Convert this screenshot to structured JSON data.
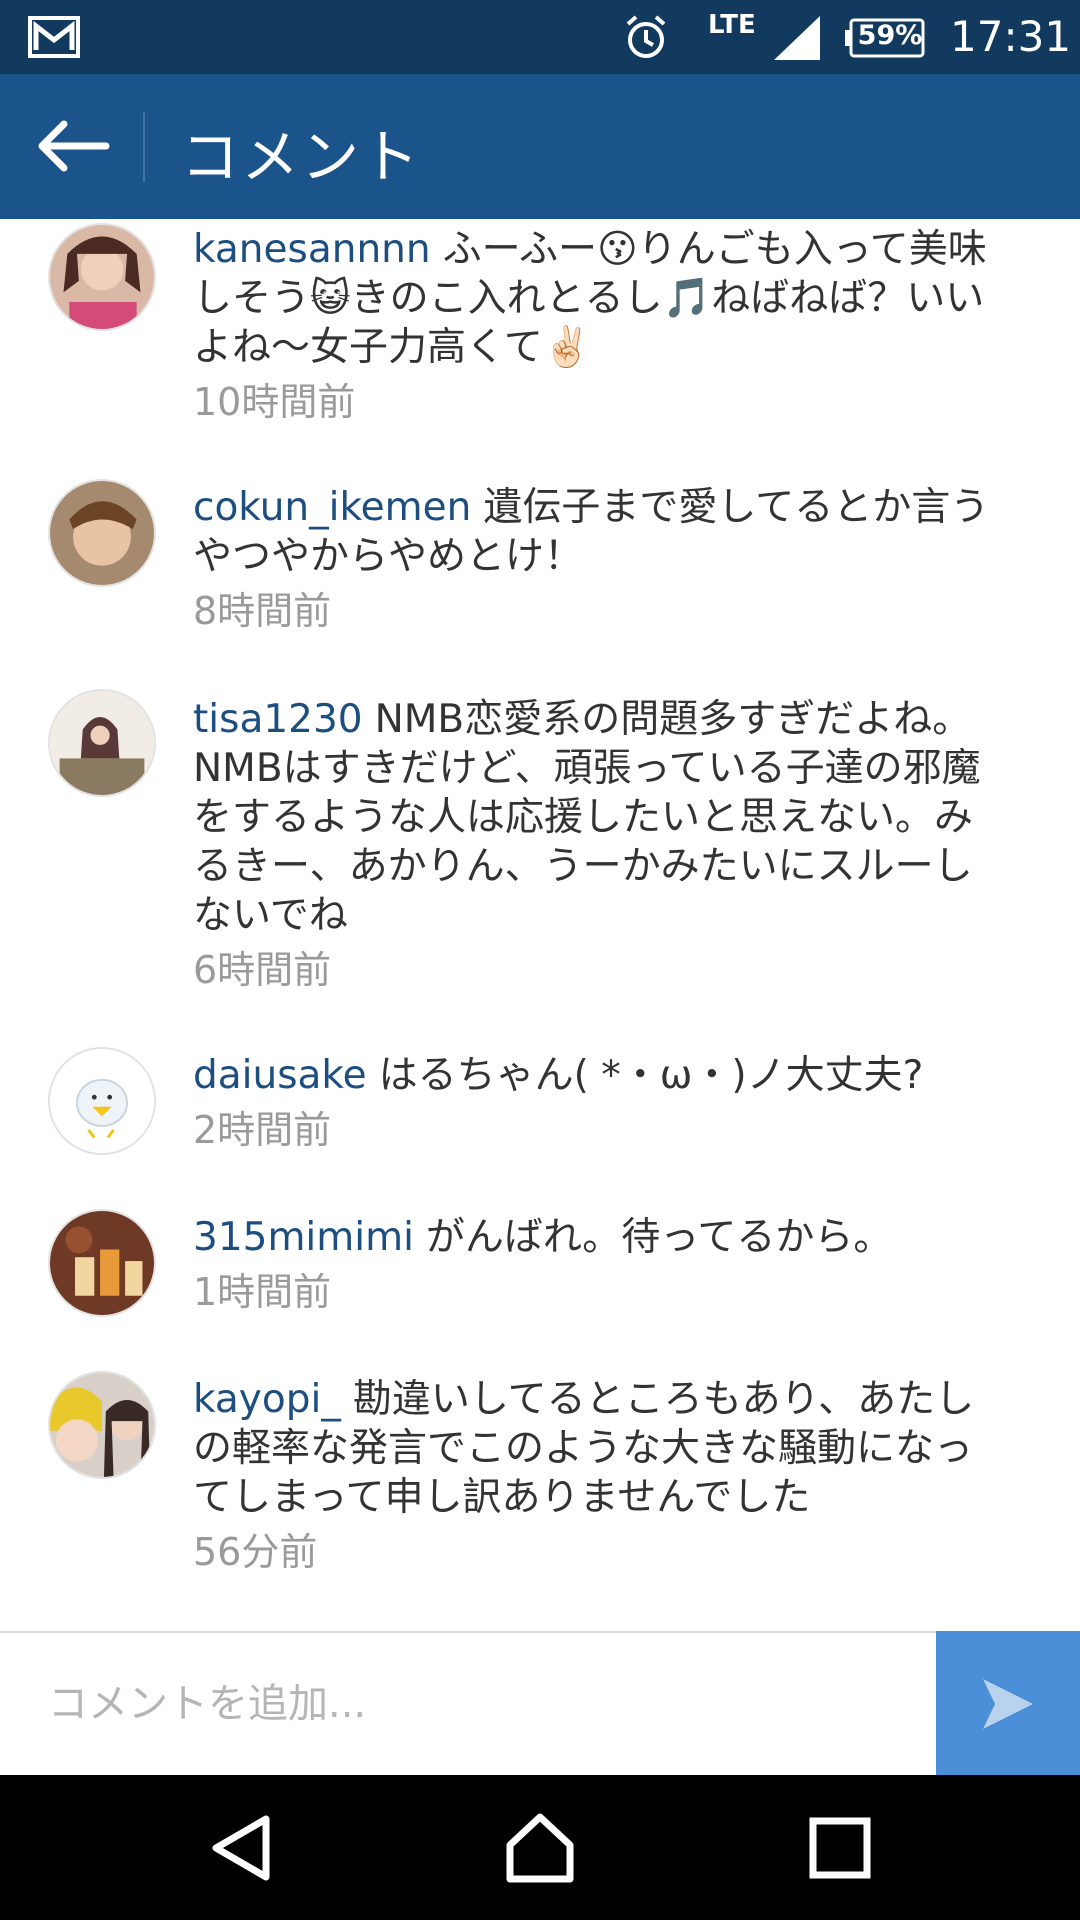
{
  "status_bar": {
    "network": "LTE",
    "battery": "59%",
    "time": "17:31",
    "icons": [
      "mail-icon",
      "alarm-icon",
      "signal-icon",
      "battery-icon"
    ]
  },
  "header": {
    "title": "コメント",
    "back_icon": "arrow-left-icon"
  },
  "comments": [
    {
      "username": "kanesannnn",
      "text": "ふーふー😗りんごも入って美味しそう😺きのこ入れとるし🎵ねばねば？いいよね〜女子力高くて✌🏻",
      "time": "10時間前"
    },
    {
      "username": "cokun_ikemen",
      "text": "遺伝子まで愛してるとか言うやつやからやめとけ！",
      "time": "8時間前"
    },
    {
      "username": "tisa1230",
      "text": "NMB恋愛系の問題多すぎだよね。NMBはすきだけど、頑張っている子達の邪魔をするような人は応援したいと思えない。みるきー、あかりん、うーかみたいにスルーしないでね",
      "time": "6時間前"
    },
    {
      "username": "daiusake",
      "text": "はるちゃん( *・ω・)ノ大丈夫?",
      "time": "2時間前"
    },
    {
      "username": "315mimimi",
      "text": "がんばれ。待ってるから。",
      "time": "1時間前"
    },
    {
      "username": "kayopi_",
      "text": "勘違いしてるところもあり、あたしの軽率な発言でこのような大きな騒動になってしまって申し訳ありませんでした",
      "time": "56分前"
    }
  ],
  "input": {
    "placeholder": "コメントを追加...",
    "send_icon": "send-icon"
  },
  "nav_bar": {
    "icons": [
      "back-triangle-icon",
      "home-icon",
      "recents-icon"
    ]
  },
  "colors": {
    "status_bar": "#123a5e",
    "header": "#1a548a",
    "username": "#1d4e80",
    "timestamp": "#9a9a9a",
    "send_button": "#4a8fd8"
  }
}
